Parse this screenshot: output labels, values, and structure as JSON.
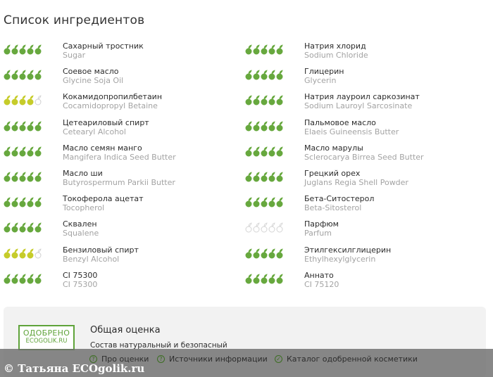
{
  "page": {
    "title": "Список ингредиентов"
  },
  "colors": {
    "green": "#67a83e",
    "yellow": "#c6cc2a",
    "gray": "#d4d4d4",
    "outline": "#cfcfcf"
  },
  "ingredients": {
    "left": [
      {
        "name": "Сахарный тростник",
        "latin": "Sugar",
        "rating": 5,
        "level": "green"
      },
      {
        "name": "Соевое масло",
        "latin": "Glycine Soja Oil",
        "rating": 5,
        "level": "green"
      },
      {
        "name": "Кокамидопропилбетаин",
        "latin": "Cocamidopropyl Betaine",
        "rating": 4,
        "level": "yellow"
      },
      {
        "name": "Цетеариловый спирт",
        "latin": "Cetearyl Alcohol",
        "rating": 5,
        "level": "green"
      },
      {
        "name": "Масло семян манго",
        "latin": "Mangifera Indica Seed Butter",
        "rating": 5,
        "level": "green"
      },
      {
        "name": "Масло ши",
        "latin": "Butyrospermum Parkii Butter",
        "rating": 5,
        "level": "green"
      },
      {
        "name": "Токоферола ацетат",
        "latin": "Tocopherol",
        "rating": 5,
        "level": "green"
      },
      {
        "name": "Сквален",
        "latin": "Squalene",
        "rating": 5,
        "level": "green"
      },
      {
        "name": "Бензиловый спирт",
        "latin": "Benzyl Alcohol",
        "rating": 4,
        "level": "yellow"
      },
      {
        "name": "CI 75300",
        "latin": "CI 75300",
        "rating": 5,
        "level": "green"
      }
    ],
    "right": [
      {
        "name": "Натрия хлорид",
        "latin": "Sodium Chloride",
        "rating": 5,
        "level": "green"
      },
      {
        "name": "Глицерин",
        "latin": "Glycerin",
        "rating": 5,
        "level": "green"
      },
      {
        "name": "Натрия лауроил саркозинат",
        "latin": "Sodium Lauroyl Sarcosinate",
        "rating": 5,
        "level": "green"
      },
      {
        "name": "Пальмовое масло",
        "latin": "Elaeis Guineensis Butter",
        "rating": 5,
        "level": "green"
      },
      {
        "name": "Масло марулы",
        "latin": "Sclerocarya Birrea Seed Butter",
        "rating": 5,
        "level": "green"
      },
      {
        "name": "Грецкий орех",
        "latin": "Juglans Regia Shell Powder",
        "rating": 5,
        "level": "green"
      },
      {
        "name": "Бета-Ситостерол",
        "latin": "Beta-Sitosterol",
        "rating": 5,
        "level": "green"
      },
      {
        "name": "Парфюм",
        "latin": "Parfum",
        "rating": 0,
        "level": "gray"
      },
      {
        "name": "Этилгексилглицерин",
        "latin": "Ethylhexylglycerin",
        "rating": 5,
        "level": "green"
      },
      {
        "name": "Аннато",
        "latin": "CI 75120",
        "rating": 5,
        "level": "green"
      }
    ]
  },
  "summary": {
    "badge_line1": "ОДОБРЕНО",
    "badge_line2": "ECOGOLIK.RU",
    "title": "Общая оценка",
    "text": "Состав натуральный и безопасный"
  },
  "links": [
    {
      "label": "Про оценки",
      "icon": "question-circle-icon",
      "glyph": "?"
    },
    {
      "label": "Источники информации",
      "icon": "question-circle-icon",
      "glyph": "?"
    },
    {
      "label": "Каталог одобренной косметики",
      "icon": "check-circle-icon",
      "glyph": "✓"
    }
  ],
  "watermark": "© Татьяна ECOgolik.ru"
}
